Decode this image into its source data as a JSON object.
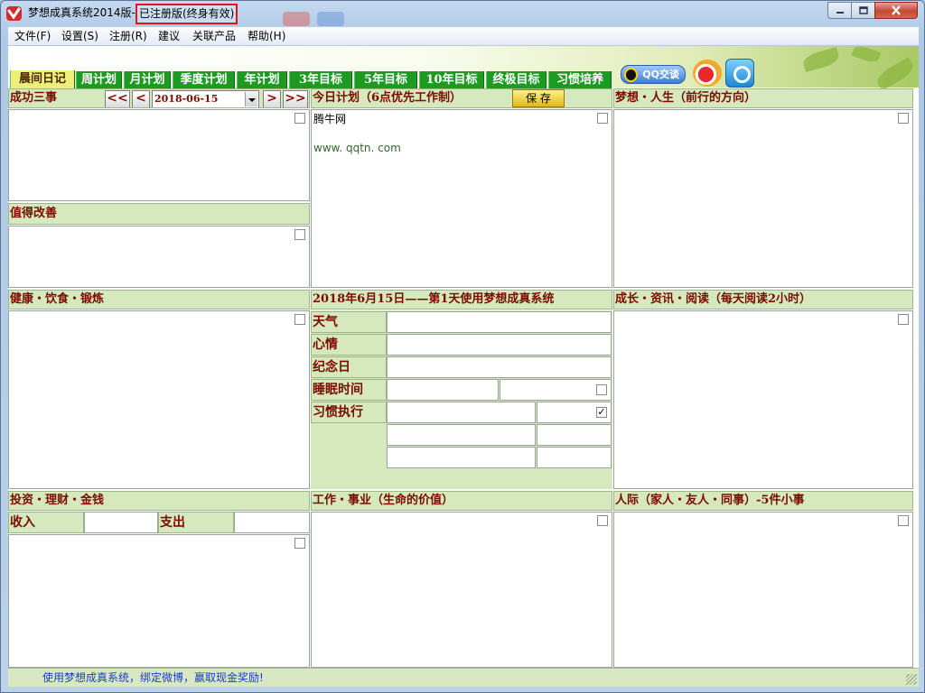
{
  "window": {
    "title": "梦想成真系统2014版-",
    "badge": "已注册版(终身有效)"
  },
  "menu": [
    "文件(F)",
    "设置(S)",
    "注册(R)",
    "建议",
    "关联产品",
    "帮助(H)"
  ],
  "tabs": [
    {
      "label": "晨间日记",
      "active": true
    },
    {
      "label": "周计划",
      "active": false
    },
    {
      "label": "月计划",
      "active": false
    },
    {
      "label": "季度计划",
      "active": false
    },
    {
      "label": "年计划",
      "active": false
    },
    {
      "label": "3年目标",
      "active": false
    },
    {
      "label": "5年目标",
      "active": false
    },
    {
      "label": "10年目标",
      "active": false
    },
    {
      "label": "终极目标",
      "active": false
    },
    {
      "label": "习惯培养",
      "active": false
    }
  ],
  "toolbar": {
    "qq_label": "QQ交谈",
    "weibo_icon": "weibo-icon",
    "tencent_weibo_icon": "tencent-weibo-icon"
  },
  "success": {
    "title": "成功三事",
    "first_label": "<<",
    "prev_label": "<",
    "date": "2018-06-15",
    "next_label": ">",
    "last_label": ">>",
    "checked": false
  },
  "improve": {
    "title": "值得改善",
    "checked": false
  },
  "plan": {
    "title": "今日计划（6点优先工作制）",
    "save_label": "保 存",
    "line1": "腾牛网",
    "line2": "www. qqtn. com",
    "checked": false
  },
  "dream": {
    "title": "梦想・人生（前行的方向）",
    "checked": false
  },
  "health": {
    "title": "健康・饮食・锻炼",
    "checked": false
  },
  "diary": {
    "title": "2018年6月15日——第1天使用梦想成真系统",
    "weather_label": "天气",
    "mood_label": "心情",
    "anniversary_label": "纪念日",
    "sleep_label": "睡眠时间",
    "sleep_checked": false,
    "habit_label": "习惯执行",
    "habit_checked": true
  },
  "growth": {
    "title": "成长・资讯・阅读（每天阅读2小时）",
    "checked": false
  },
  "finance": {
    "title": "投资・理财・金钱",
    "income_label": "收入",
    "expense_label": "支出",
    "checked": false
  },
  "work": {
    "title": "工作・事业（生命的价值）",
    "checked": false
  },
  "social": {
    "title": "人际（家人・友人・同事）-5件小事",
    "checked": false
  },
  "status": {
    "text": "使用梦想成真系统，绑定微博，赢取现金奖励!"
  },
  "colors": {
    "header_bg": "#d6e8bd",
    "header_text": "#7a0c00",
    "tab_bg": "#1d9a22",
    "tab_active_bg": "#ecf07a",
    "status_text": "#1a3ec8",
    "badge_border": "#e0141c"
  }
}
